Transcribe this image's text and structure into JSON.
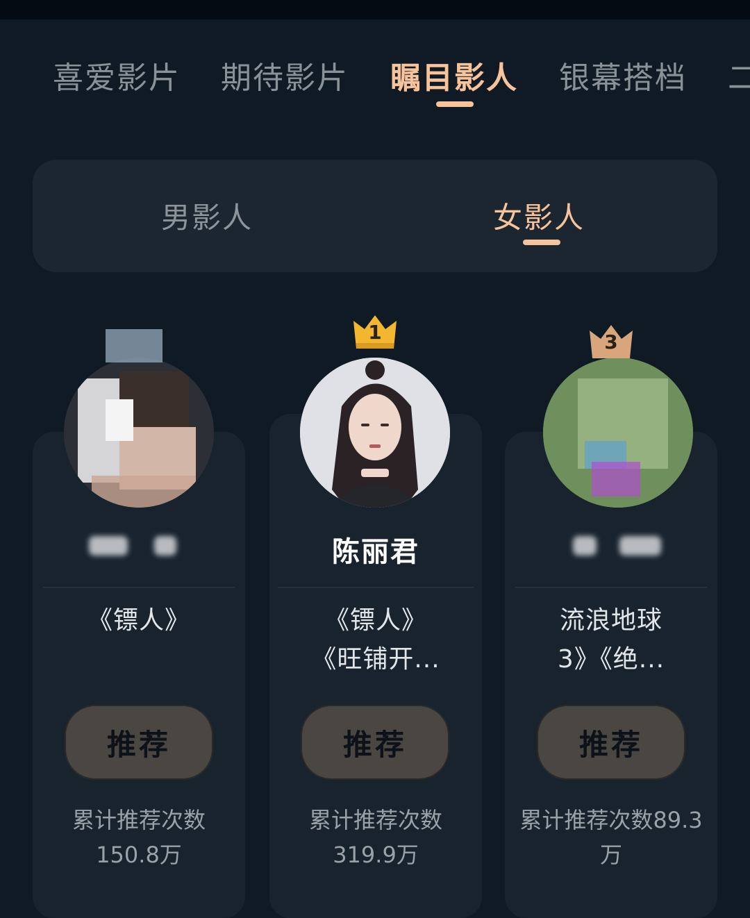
{
  "tabs": [
    {
      "label": "喜爱影片"
    },
    {
      "label": "期待影片"
    },
    {
      "label": "瞩目影人"
    },
    {
      "label": "银幕搭档"
    },
    {
      "label": "二"
    }
  ],
  "active_tab": "瞩目影人",
  "gender_tabs": {
    "male": "男影人",
    "female": "女影人",
    "active": "女影人"
  },
  "cards": [
    {
      "works_line1": "《镖人》",
      "works_line2": "",
      "button": "推荐",
      "stat_line1": "累计推荐次数",
      "stat_line2": "150.8万"
    },
    {
      "rank": "1",
      "name": "陈丽君",
      "works_line1": "《镖人》",
      "works_line2": "《旺铺开...",
      "button": "推荐",
      "stat_line1": "累计推荐次数",
      "stat_line2": "319.9万"
    },
    {
      "rank": "3",
      "works_line1": "流浪地球",
      "works_line2": "3》《绝...",
      "button": "推荐",
      "stat_line1": "累计推荐次数89.3",
      "stat_line2": "万"
    }
  ],
  "colors": {
    "accent": "#f7c39a",
    "background": "#0f1a24",
    "card": "#18232e",
    "button": "#4a4641",
    "gold": "#f2b72f",
    "bronze": "#d9a57c"
  }
}
